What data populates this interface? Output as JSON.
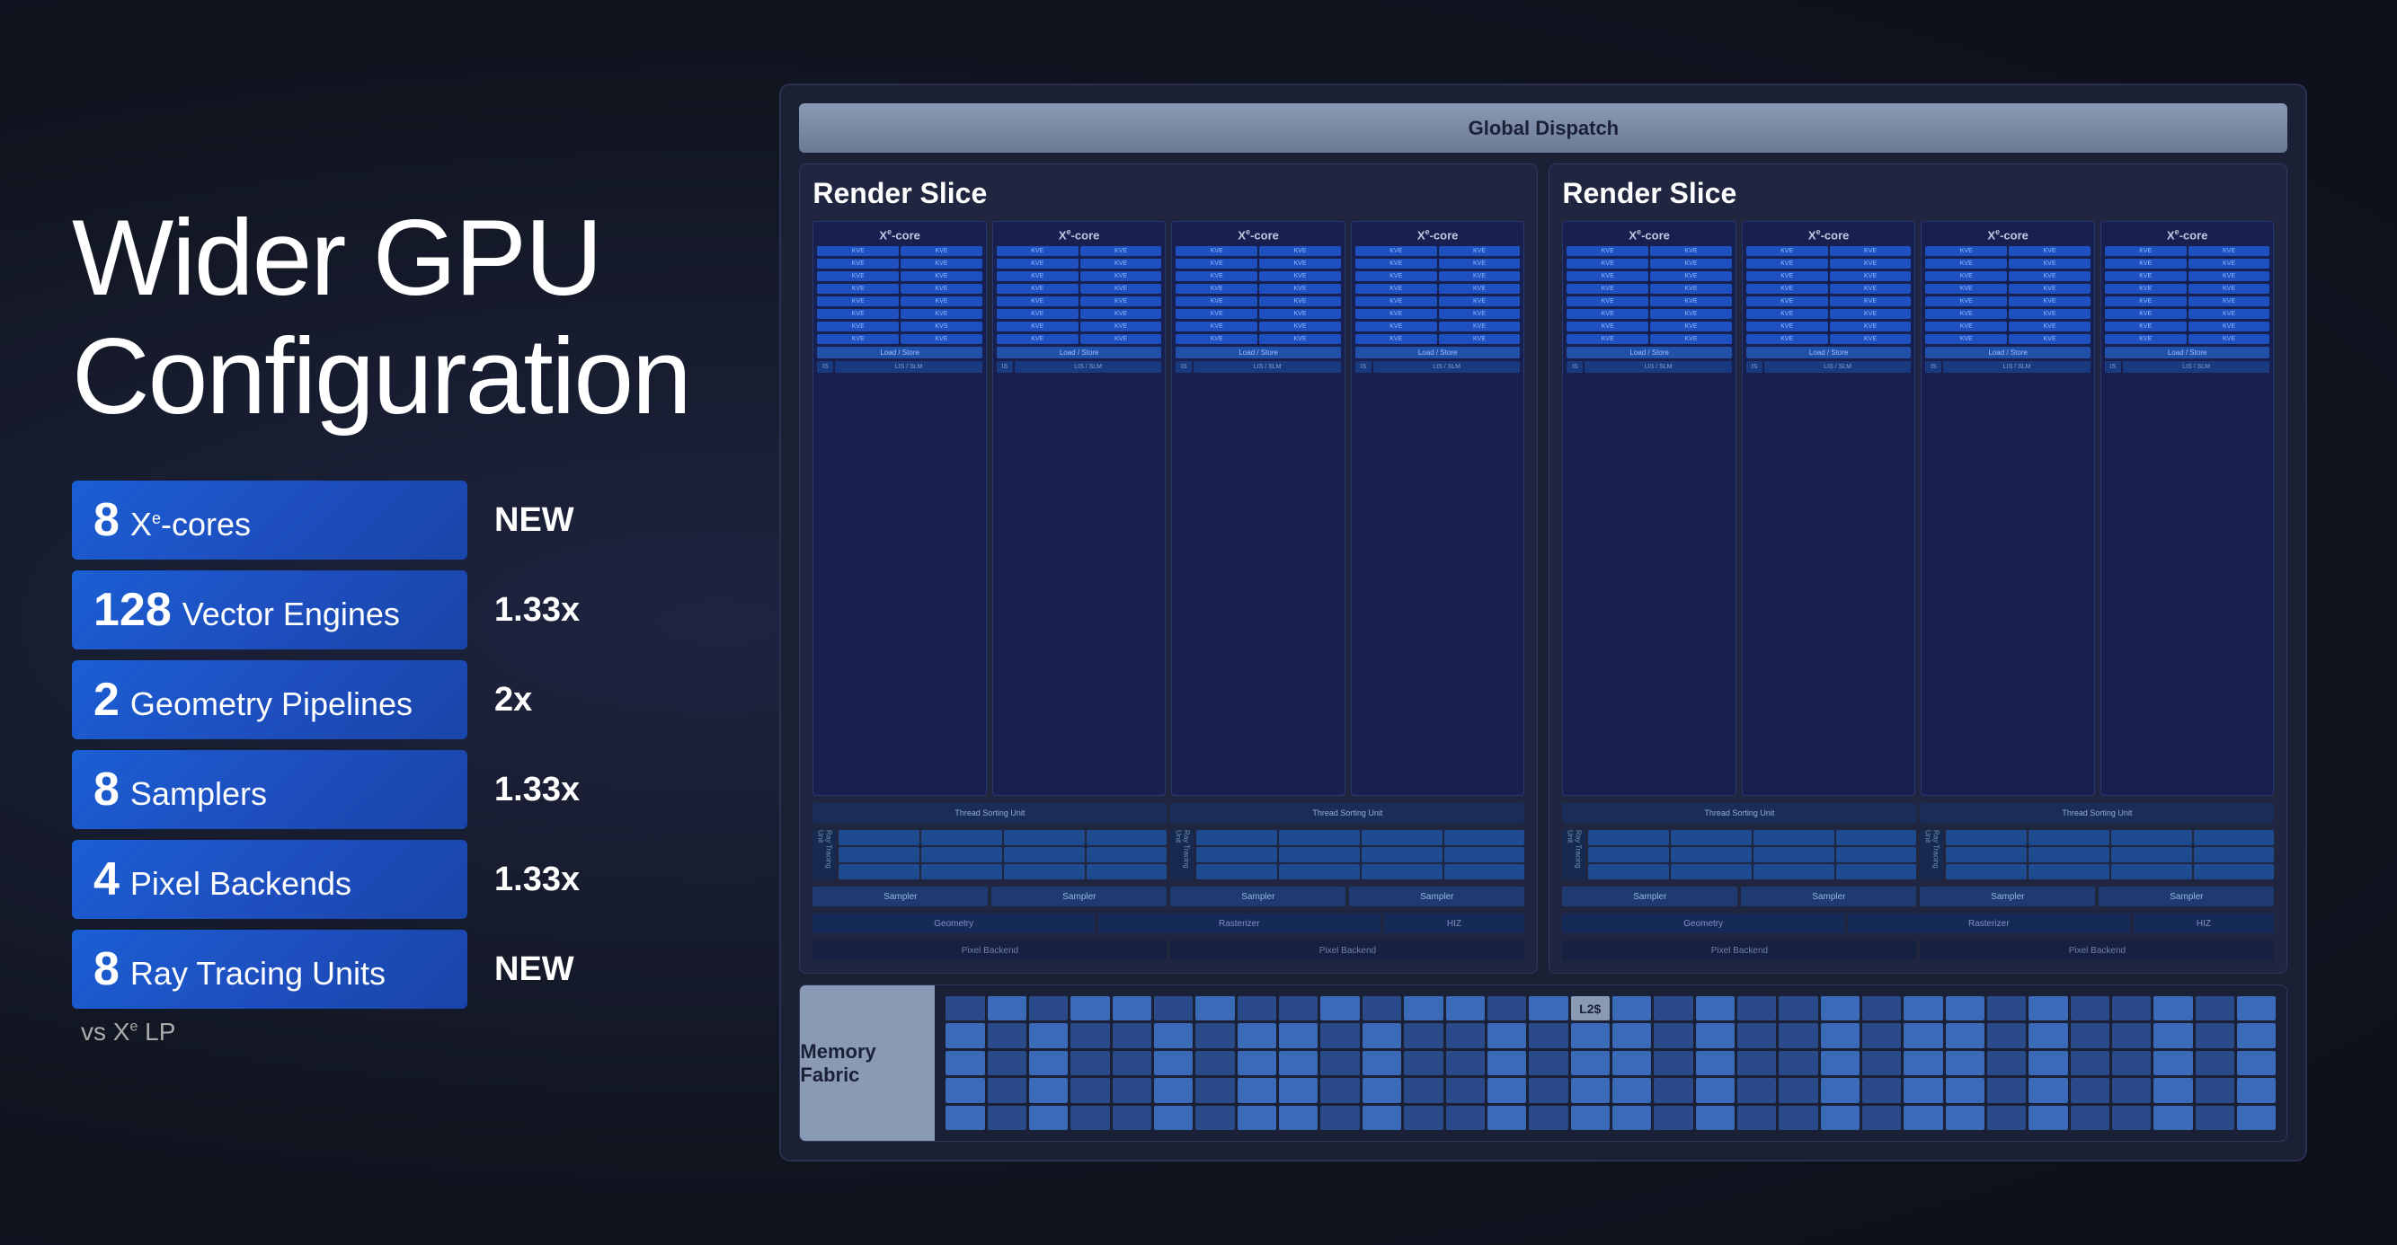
{
  "page": {
    "title": "Wider GPU Configuration",
    "background_color": "#1a1e2e"
  },
  "left": {
    "title_line1": "Wider GPU",
    "title_line2": "Configuration",
    "stats": [
      {
        "number": "8",
        "label": "Xe-cores",
        "sup": "e",
        "multiplier": "NEW"
      },
      {
        "number": "128",
        "label": "Vector Engines",
        "multiplier": "1.33x"
      },
      {
        "number": "2",
        "label": "Geometry Pipelines",
        "multiplier": "2x"
      },
      {
        "number": "8",
        "label": "Samplers",
        "multiplier": "1.33x"
      },
      {
        "number": "4",
        "label": "Pixel Backends",
        "multiplier": "1.33x"
      },
      {
        "number": "8",
        "label": "Ray Tracing Units",
        "multiplier": "NEW"
      }
    ],
    "vs_label": "vs X",
    "vs_sup": "e",
    "vs_suffix": " LP"
  },
  "diagram": {
    "global_dispatch": "Global Dispatch",
    "render_slice_label": "Render Slice",
    "xe_core_label": "X",
    "xe_sup": "e",
    "xe_suffix": "-core",
    "kve_label": "KVE",
    "kve2": "KVE",
    "load_store": "Load / Store",
    "is_label": "IS",
    "lis_slm": "LIS / SLM",
    "thread_sorting": "Thread Sorting Unit",
    "ray_tracing": "Ray Tracing Unit",
    "sampler": "Sampler",
    "geometry": "Geometry",
    "rasterizer": "Rasterizer",
    "hiz": "HIZ",
    "pixel_backend": "Pixel Backend",
    "memory_fabric": "Memory Fabric",
    "l2_cache": "L2$"
  }
}
